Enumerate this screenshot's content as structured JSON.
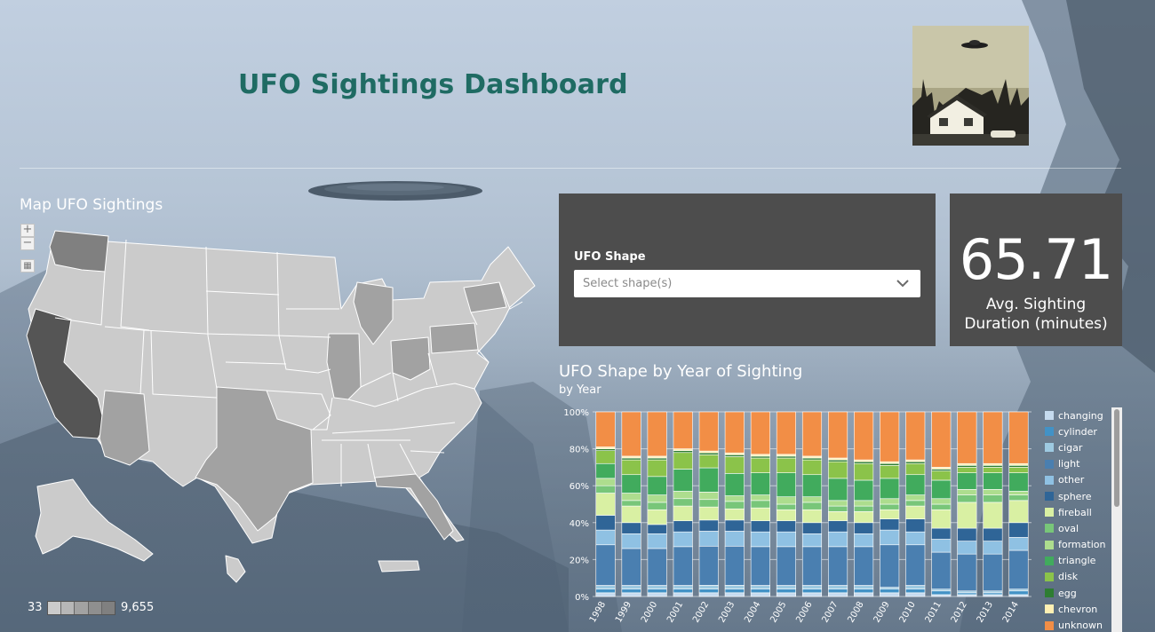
{
  "header": {
    "title": "UFO Sightings Dashboard"
  },
  "map": {
    "title": "Map UFO Sightings",
    "zoom_in": "+",
    "zoom_out": "−",
    "home_icon": "building-icon",
    "legend_min": "33",
    "legend_max": "9,655",
    "colors": {
      "high": "#555555",
      "mid_high": "#808080",
      "mid": "#a2a2a2",
      "low": "#cbcbcb"
    }
  },
  "filter": {
    "label": "UFO Shape",
    "placeholder": "Select shape(s)",
    "icon": "chevron-down-icon"
  },
  "kpi": {
    "value": "65.71",
    "label_line1": "Avg. Sighting",
    "label_line2": "Duration (minutes)"
  },
  "chart_data": {
    "type": "bar",
    "stacked": "percent",
    "title": "UFO Shape by Year of Sighting",
    "subtitle": "by Year",
    "categories": [
      "1998",
      "1999",
      "2000",
      "2001",
      "2002",
      "2003",
      "2004",
      "2005",
      "2006",
      "2007",
      "2008",
      "2009",
      "2010",
      "2011",
      "2012",
      "2013",
      "2014"
    ],
    "ylim": [
      0,
      100
    ],
    "yticks": [
      "0%",
      "20%",
      "40%",
      "60%",
      "80%",
      "100%"
    ],
    "grid": true,
    "legend_position": "right",
    "series": [
      {
        "name": "changing",
        "color": "#c6dbef",
        "values": [
          2,
          2,
          2,
          2,
          2,
          2,
          2,
          2,
          2,
          2,
          2,
          2,
          2,
          1,
          1,
          1,
          1
        ]
      },
      {
        "name": "cylinder",
        "color": "#4292c6",
        "values": [
          2,
          2,
          2,
          2,
          2,
          2,
          2,
          2,
          2,
          2,
          2,
          2,
          2,
          2,
          1,
          1,
          2
        ]
      },
      {
        "name": "cigar",
        "color": "#9ecae1",
        "values": [
          2,
          2,
          2,
          2,
          2,
          2,
          2,
          2,
          2,
          2,
          2,
          1,
          2,
          1,
          1,
          1,
          1
        ]
      },
      {
        "name": "light",
        "color": "#4a7fb0",
        "values": [
          22,
          20,
          20,
          21,
          21,
          21,
          21,
          21,
          21,
          21,
          21,
          23,
          22,
          20,
          20,
          20,
          21
        ]
      },
      {
        "name": "other",
        "color": "#8fc1e3",
        "values": [
          8,
          8,
          8,
          8,
          8,
          8,
          8,
          8,
          7,
          8,
          7,
          8,
          7,
          7,
          7,
          7,
          7
        ]
      },
      {
        "name": "sphere",
        "color": "#2f6597",
        "values": [
          8,
          6,
          5,
          6,
          6,
          6,
          6,
          6,
          6,
          6,
          6,
          6,
          7,
          6,
          7,
          7,
          8
        ]
      },
      {
        "name": "fireball",
        "color": "#d9f0a3",
        "values": [
          12,
          9,
          8,
          8,
          7,
          6,
          7,
          6,
          7,
          5,
          6,
          5,
          7,
          10,
          14,
          14,
          12
        ]
      },
      {
        "name": "oval",
        "color": "#78c679",
        "values": [
          4,
          3,
          4,
          4,
          4,
          4,
          4,
          3,
          4,
          3,
          3,
          3,
          3,
          3,
          4,
          4,
          3
        ]
      },
      {
        "name": "formation",
        "color": "#addd8e",
        "values": [
          4,
          4,
          4,
          4,
          4,
          3,
          3,
          4,
          3,
          3,
          3,
          3,
          3,
          3,
          3,
          3,
          2
        ]
      },
      {
        "name": "triangle",
        "color": "#41ab5d",
        "values": [
          8,
          10,
          10,
          12,
          13,
          12,
          12,
          13,
          12,
          12,
          11,
          11,
          11,
          10,
          9,
          9,
          10
        ]
      },
      {
        "name": "disk",
        "color": "#8bc34a",
        "values": [
          7,
          8,
          9,
          9,
          7,
          9,
          8,
          8,
          8,
          9,
          9,
          7,
          6,
          5,
          3,
          3,
          3
        ]
      },
      {
        "name": "egg",
        "color": "#2e7d32",
        "values": [
          1,
          1,
          1,
          1,
          1,
          1,
          1,
          1,
          1,
          1,
          1,
          1,
          1,
          1,
          1,
          1,
          1
        ]
      },
      {
        "name": "chevron",
        "color": "#fff0b3",
        "values": [
          1,
          1,
          1,
          1,
          1,
          1,
          1,
          1,
          1,
          1,
          1,
          1,
          1,
          1,
          1,
          1,
          1
        ]
      },
      {
        "name": "unknown",
        "color": "#f28e46",
        "values": [
          19,
          24,
          24,
          20,
          21,
          22,
          23,
          23,
          24,
          25,
          26,
          27,
          26,
          30,
          28,
          28,
          28
        ]
      }
    ]
  }
}
